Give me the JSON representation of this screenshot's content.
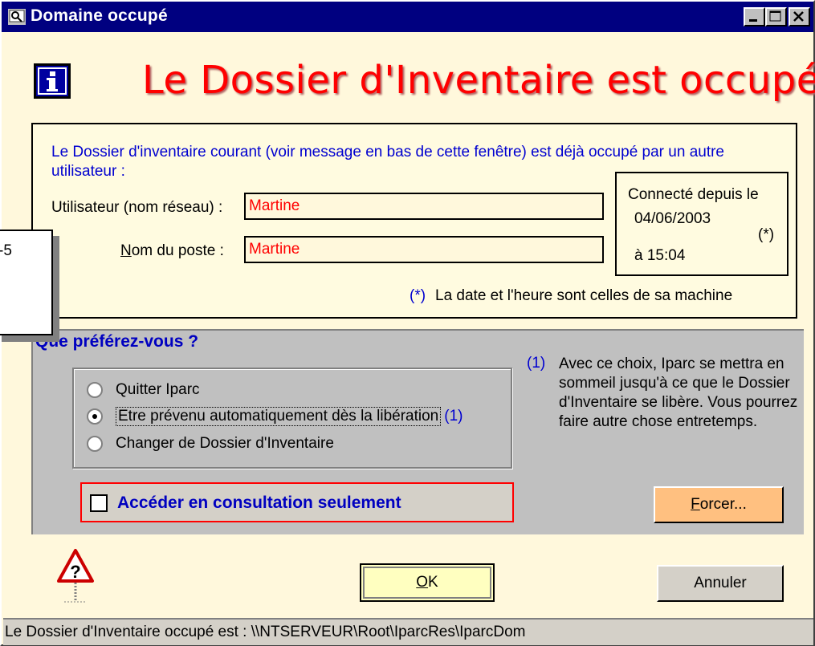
{
  "window": {
    "title": "Domaine occupé",
    "controls": [
      "minimize",
      "maximize",
      "close"
    ]
  },
  "heading": "Le Dossier d'Inventaire est occupé",
  "info": {
    "description": "Le Dossier d'inventaire courant (voir message en bas de cette fenêtre) est déjà occupé par un autre utilisateur :",
    "user_label": "Utilisateur (nom réseau) :",
    "user_value": "Martine",
    "post_label_accel": "N",
    "post_label_rest": "om du poste :",
    "post_value": "Martine",
    "connected_label": "Connecté depuis le",
    "connected_date": "04/06/2003",
    "connected_time": "à 15:04",
    "asterisk": "(*)",
    "footnote_marker": "(*)",
    "footnote": "La date et l'heure sont celles de sa machine"
  },
  "choice": {
    "question": "Que préférez-vous ?",
    "options": [
      {
        "label": "Quitter Iparc",
        "checked": false
      },
      {
        "label": "Etre prévenu automatiquement dès la libération",
        "checked": true
      },
      {
        "label": "Changer de Dossier d'Inventaire",
        "checked": false
      }
    ],
    "option_note_marker": "(1)",
    "note_marker": "(1)",
    "note_text": "Avec ce choix, Iparc se mettra en sommeil jusqu'à ce que le Dossier d'Inventaire se libère. Vous pourrez faire autre chose entretemps.",
    "readonly_label": "Accéder en consultation seulement",
    "readonly_checked": false,
    "force_accel": "F",
    "force_rest": "orcer..."
  },
  "buttons": {
    "ok_accel": "O",
    "ok_rest": "K",
    "cancel": "Annuler"
  },
  "colors": {
    "title_bar": "#000080",
    "heading": "#ff0000",
    "info_text": "#0000d0",
    "ok_button": "#ffffc0",
    "force_button": "#ffc080"
  },
  "statusbar": "Le Dossier d'Inventaire occupé est : \\\\NTSERVEUR\\Root\\IparcRes\\IparcDom",
  "tooltip": "-5"
}
